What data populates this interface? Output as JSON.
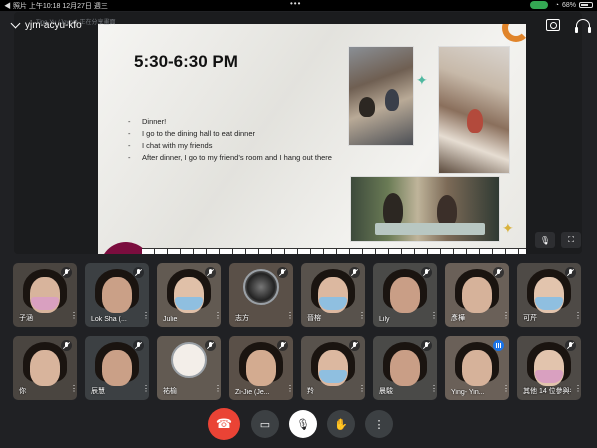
{
  "status_bar": {
    "left": "◀ 照片   上午10:18   12月27日 週三",
    "dots": "•••",
    "battery": "68%"
  },
  "meeting": {
    "code": "yjm-acyu-kfo",
    "sharing_text": "Ting-Yu (Joyce) 正在分享畫面"
  },
  "slide": {
    "title": "5:30-6:30 PM",
    "bullets": [
      "Dinner!",
      "I go to the dining hall to eat dinner",
      "I chat with my friends",
      "After dinner, I go to my friend’s room and I hang out there"
    ]
  },
  "participants": [
    {
      "name": "子涵",
      "mask": "#d9a0c0",
      "muted": true
    },
    {
      "name": "Lok Sha (...",
      "mask": "",
      "muted": true
    },
    {
      "name": "Julie",
      "mask": "#8fbfe0",
      "muted": true
    },
    {
      "name": "志方",
      "mask": "",
      "muted": true,
      "avatar": true
    },
    {
      "name": "晉榕",
      "mask": "#8fbfe0",
      "muted": true
    },
    {
      "name": "Lily",
      "mask": "",
      "muted": true
    },
    {
      "name": "彥樺",
      "mask": "",
      "muted": true
    },
    {
      "name": "可芹",
      "mask": "#8fbfe0",
      "muted": true
    },
    {
      "name": "你",
      "mask": "",
      "muted": true
    },
    {
      "name": "辰慧",
      "mask": "",
      "muted": true
    },
    {
      "name": "祐榆",
      "mask": "",
      "muted": true,
      "avatar": true
    },
    {
      "name": "Zi-Jie (Je...",
      "mask": "",
      "muted": true
    },
    {
      "name": "羚",
      "mask": "#8fbfe0",
      "muted": true
    },
    {
      "name": "晨駿",
      "mask": "",
      "muted": true
    },
    {
      "name": "Ying- Yin...",
      "mask": "",
      "muted": false
    },
    {
      "name": "其他 14 位參與者",
      "mask": "#d9a0c0",
      "muted": true
    }
  ],
  "icons": {
    "end_call": "phone-hangup-icon",
    "camera": "video-icon",
    "mic": "mic-off-icon",
    "hand": "raise-hand-icon",
    "more": "more-vert-icon"
  },
  "colors": {
    "end_call": "#ea4335",
    "speaking": "#1a73e8",
    "slide_accent": "#7b0d3e"
  }
}
